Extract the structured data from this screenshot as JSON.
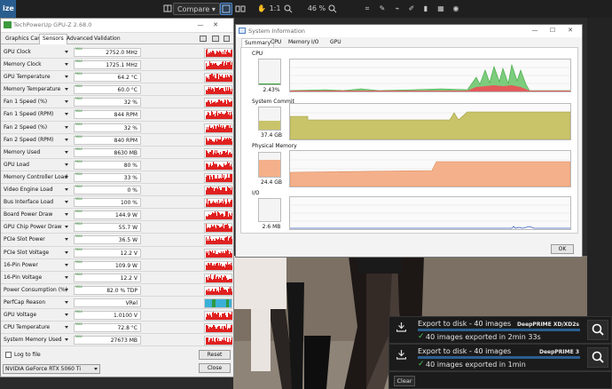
{
  "app": {
    "title_fragment": "ize",
    "compare_label": "Compare",
    "zoom_fit": "1:1",
    "zoom_percent": "46 %"
  },
  "gpuz": {
    "title": "TechPowerUp GPU-Z 2.68.0",
    "tabs": [
      "Graphics Card",
      "Sensors",
      "Advanced",
      "Validation"
    ],
    "active_tab": "Sensors",
    "sensors": [
      {
        "name": "GPU Clock",
        "value": "2752.0 MHz",
        "max": "MAX"
      },
      {
        "name": "Memory Clock",
        "value": "1725.1 MHz",
        "max": "MAX"
      },
      {
        "name": "GPU Temperature",
        "value": "64.2 °C",
        "max": "MAX"
      },
      {
        "name": "Memory Temperature",
        "value": "60.0 °C",
        "max": "MAX"
      },
      {
        "name": "Fan 1 Speed (%)",
        "value": "32 %",
        "max": "MAX"
      },
      {
        "name": "Fan 1 Speed (RPM)",
        "value": "844 RPM",
        "max": "MAX"
      },
      {
        "name": "Fan 2 Speed (%)",
        "value": "32 %",
        "max": "MAX"
      },
      {
        "name": "Fan 2 Speed (RPM)",
        "value": "840 RPM",
        "max": "MAX"
      },
      {
        "name": "Memory Used",
        "value": "8630 MB",
        "max": "MAX"
      },
      {
        "name": "GPU Load",
        "value": "80 %",
        "max": "MAX"
      },
      {
        "name": "Memory Controller Load",
        "value": "33 %",
        "max": "MAX"
      },
      {
        "name": "Video Engine Load",
        "value": "0 %",
        "max": "MAX"
      },
      {
        "name": "Bus Interface Load",
        "value": "100 %",
        "max": "MAX"
      },
      {
        "name": "Board Power Draw",
        "value": "144.9 W",
        "max": "MAX"
      },
      {
        "name": "GPU Chip Power Draw",
        "value": "55.7 W",
        "max": "MAX"
      },
      {
        "name": "PCIe Slot Power",
        "value": "36.5 W",
        "max": "MAX"
      },
      {
        "name": "PCIe Slot Voltage",
        "value": "12.2 V",
        "max": "MAX"
      },
      {
        "name": "16-Pin Power",
        "value": "109.9 W",
        "max": "MAX"
      },
      {
        "name": "16-Pin Voltage",
        "value": "12.2 V",
        "max": "MAX"
      },
      {
        "name": "Power Consumption (%)",
        "value": "82.0 % TDP",
        "max": "MAX"
      },
      {
        "name": "PerfCap Reason",
        "value": "VRel",
        "max": ""
      },
      {
        "name": "GPU Voltage",
        "value": "1.0100 V",
        "max": "MAX"
      },
      {
        "name": "CPU Temperature",
        "value": "72.8 °C",
        "max": "MAX"
      },
      {
        "name": "System Memory Used",
        "value": "27673 MB",
        "max": "MAX"
      }
    ],
    "log_to_file_label": "Log to file",
    "reset_label": "Reset",
    "gpu_select_value": "NVIDIA GeForce RTX 5060 Ti",
    "close_label": "Close"
  },
  "sysinfo": {
    "title": "System Information",
    "tabs": [
      "Summary",
      "CPU",
      "Memory",
      "I/O",
      "GPU"
    ],
    "active_tab": "Summary",
    "sections": [
      {
        "label": "CPU",
        "value": "2.43%",
        "level": 0.03
      },
      {
        "label": "System Commit",
        "value": "37.4 GB",
        "level": 0.42
      },
      {
        "label": "Physical Memory",
        "value": "24.4 GB",
        "level": 0.72
      },
      {
        "label": "I/O",
        "value": "2.6  MB",
        "level": 0.0
      }
    ],
    "ok_label": "OK"
  },
  "exports": [
    {
      "title": "Export to disk - 40 images",
      "preset": "DeepPRIME XD/XD2s",
      "status": "40 images exported in 2min 33s"
    },
    {
      "title": "Export to disk - 40 images",
      "preset": "DeepPRIME 3",
      "status": "40 images exported in 1min"
    }
  ],
  "clear_label": "Clear",
  "colors": {
    "accent": "#4b8ed8",
    "gpuz_graph": "#e02020",
    "cpu_graph": "#3aa53a",
    "commit_fill": "#c9c46a",
    "memory_fill": "#f4b08a",
    "success_check": "#47c75a"
  }
}
